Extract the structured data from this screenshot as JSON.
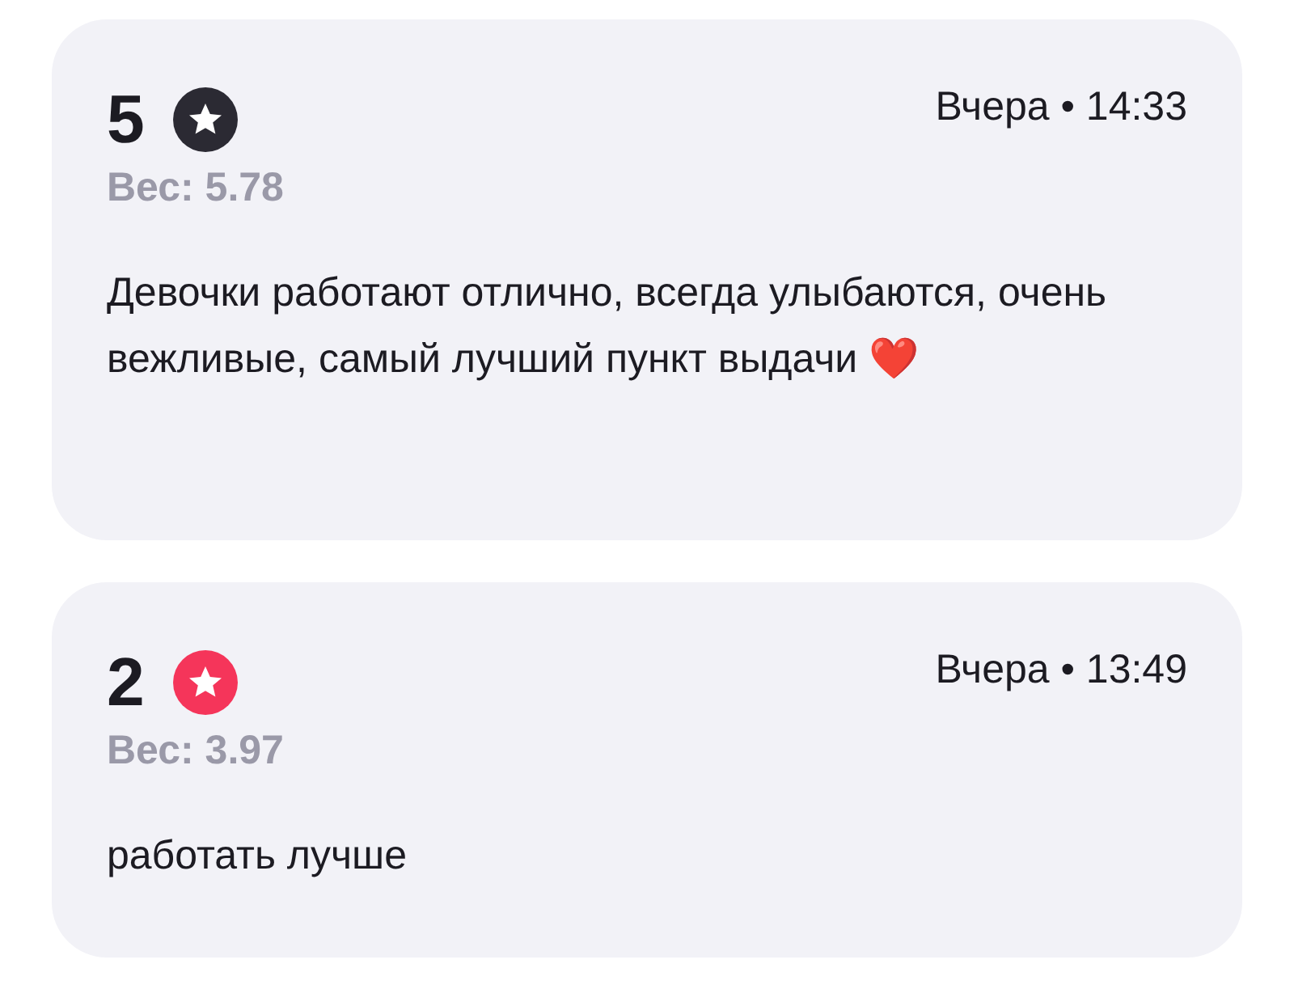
{
  "reviews": [
    {
      "rating": "5",
      "color": "#2b2a33",
      "weight": "Вес: 5.78",
      "time": "Вчера • 14:33",
      "text": "Девочки работают отлично, всегда улыбаются, очень вежливые, самый лучший пункт выдачи ❤️"
    },
    {
      "rating": "2",
      "color": "#f5355a",
      "weight": "Вес: 3.97",
      "time": "Вчера • 13:49",
      "text": "работать лучше"
    }
  ]
}
